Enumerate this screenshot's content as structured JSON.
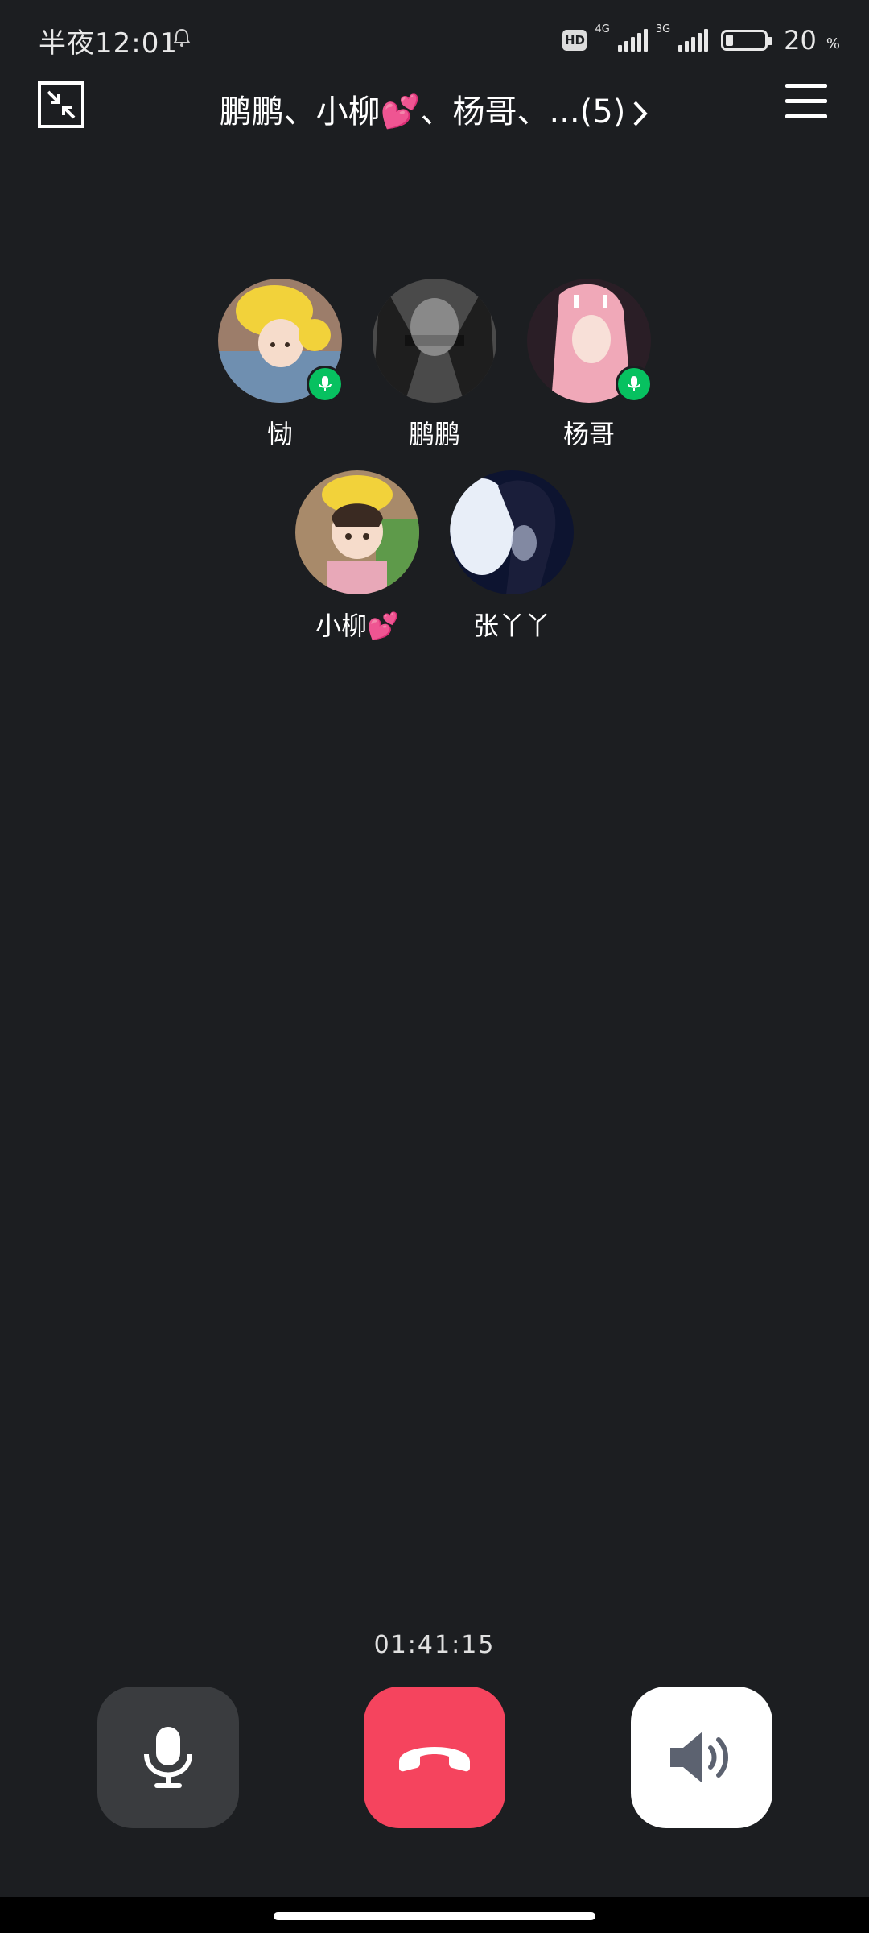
{
  "status_bar": {
    "time": "半夜12:01",
    "hd_label": "HD",
    "net1": "4G",
    "net2": "3G",
    "battery_percent": "20",
    "battery_unit": "%"
  },
  "header": {
    "title": "鹏鹏、小柳💕、杨哥、...(5)"
  },
  "participants": [
    {
      "name": "恸",
      "speaking": true
    },
    {
      "name": "鹏鹏",
      "speaking": false
    },
    {
      "name": "杨哥",
      "speaking": true
    },
    {
      "name": "小柳💕",
      "speaking": false
    },
    {
      "name": "张丫丫",
      "speaking": false
    }
  ],
  "call": {
    "duration": "01:41:15"
  },
  "icons": {
    "minimize": "minimize-icon",
    "menu": "menu-icon",
    "mute": "microphone-icon",
    "hangup": "hang-up-icon",
    "speaker": "speaker-icon"
  },
  "colors": {
    "background": "#1c1e21",
    "speaking_badge": "#07c160",
    "hangup": "#f5445e",
    "control_dark": "#3a3c3f"
  }
}
